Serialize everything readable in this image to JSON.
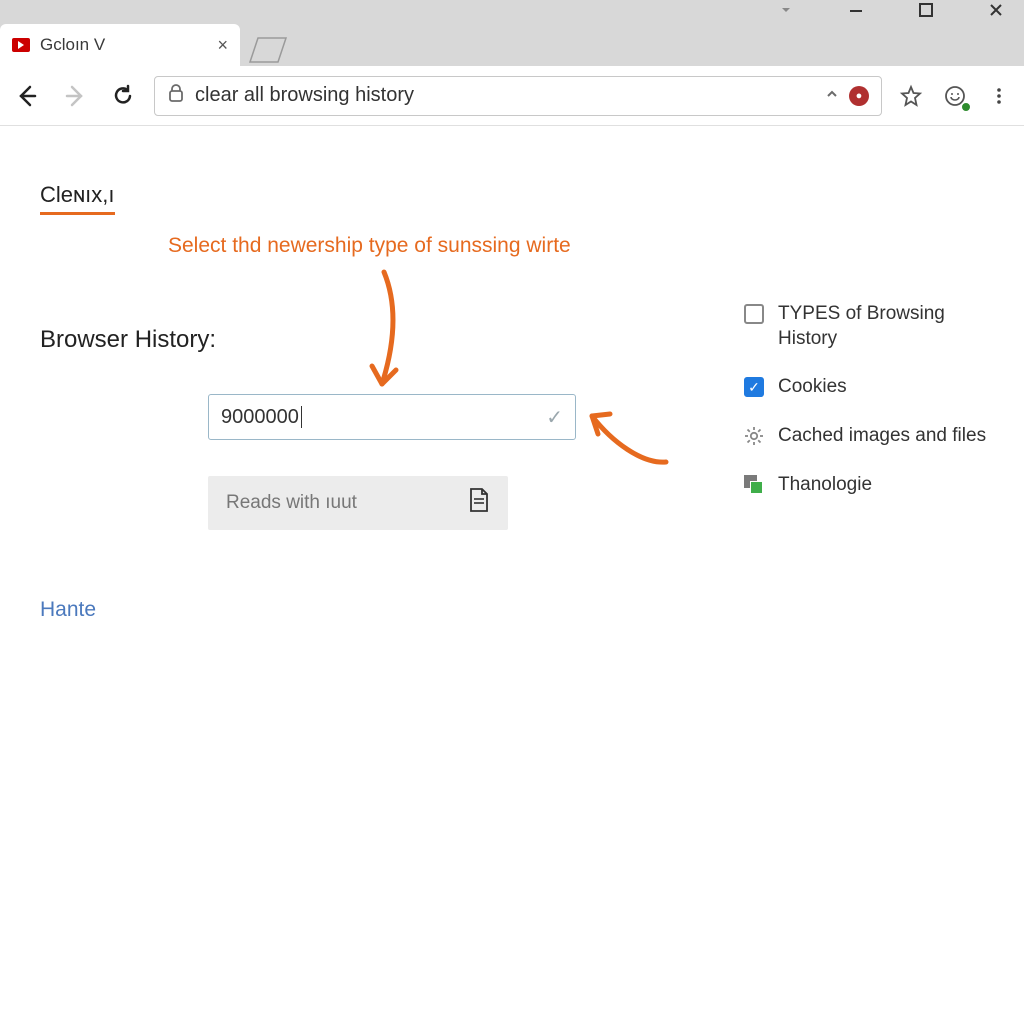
{
  "window": {
    "tab_title": "Gcloın V"
  },
  "toolbar": {
    "address": "clear all browsing history"
  },
  "page": {
    "heading": "Cleɴıx,ı",
    "annotation": "Select thd newership type of sunssing wirte",
    "section_label": "Browser History:",
    "input_value": "9000000",
    "reads_label": "Reads with ıuut",
    "link_text": "Hante"
  },
  "options": [
    {
      "label": "TYPES of Browsing History",
      "kind": "checkbox",
      "checked": false
    },
    {
      "label": "Cookies",
      "kind": "checkbox",
      "checked": true
    },
    {
      "label": "Cached images and files",
      "kind": "gear"
    },
    {
      "label": "Thanologie",
      "kind": "ticon"
    }
  ]
}
